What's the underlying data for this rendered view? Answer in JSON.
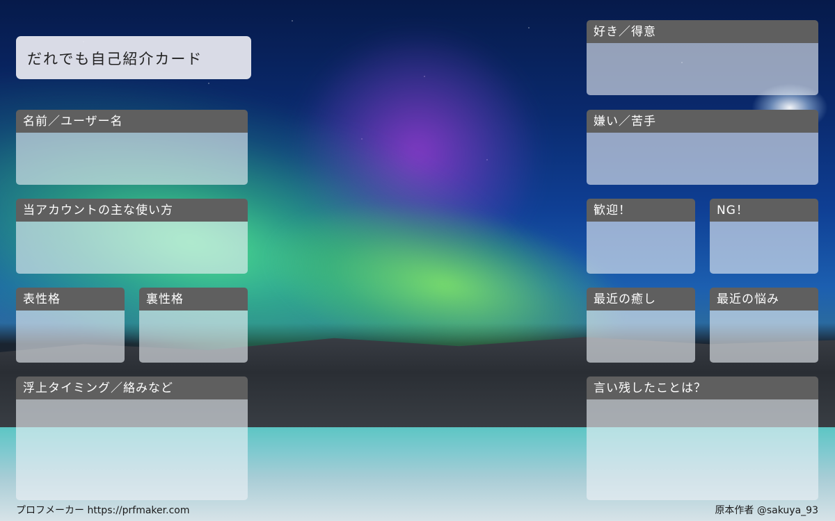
{
  "title": "だれでも自己紹介カード",
  "left_panels": {
    "name": "名前／ユーザー名",
    "usage": "当アカウントの主な使い方",
    "surface_personality": "表性格",
    "hidden_personality": "裏性格",
    "online_timing": "浮上タイミング／絡みなど"
  },
  "right_panels": {
    "likes": "好き／得意",
    "dislikes": "嫌い／苦手",
    "welcome": "歓迎！",
    "ng": "NG！",
    "recent_healing": "最近の癒し",
    "recent_worries": "最近の悩み",
    "last_words": "言い残したことは？"
  },
  "footer": {
    "maker": "プロフメーカー https://prfmaker.com",
    "original_author": "原本作者 @sakuya_93"
  }
}
